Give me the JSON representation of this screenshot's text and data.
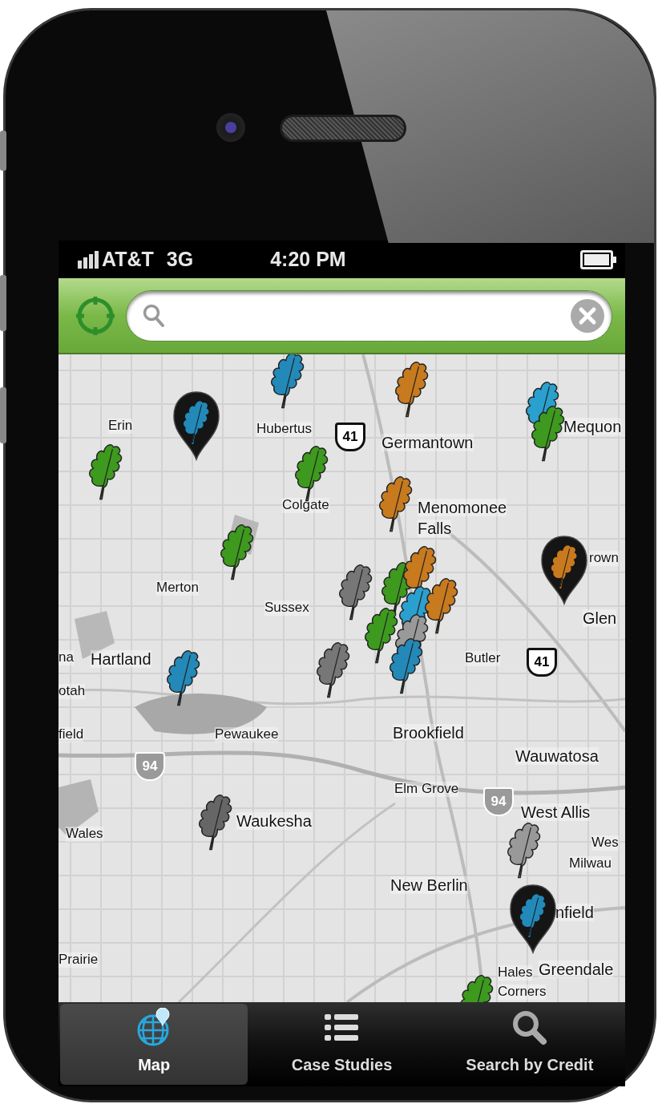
{
  "status_bar": {
    "carrier": "AT&T",
    "network": "3G",
    "time": "4:20 PM"
  },
  "map": {
    "labels": [
      {
        "text": "Erin",
        "kind": "town"
      },
      {
        "text": "Hubertus",
        "kind": "town"
      },
      {
        "text": "Germantown",
        "kind": "city"
      },
      {
        "text": "Mequon",
        "kind": "city"
      },
      {
        "text": "Colgate",
        "kind": "town"
      },
      {
        "text": "Menomonee",
        "kind": "city"
      },
      {
        "text": "Falls",
        "kind": "city"
      },
      {
        "text": "rown",
        "kind": "town"
      },
      {
        "text": "Merton",
        "kind": "town"
      },
      {
        "text": "Sussex",
        "kind": "town"
      },
      {
        "text": "Glen",
        "kind": "city"
      },
      {
        "text": "na",
        "kind": "town"
      },
      {
        "text": "Hartland",
        "kind": "city"
      },
      {
        "text": "Butler",
        "kind": "town"
      },
      {
        "text": "otah",
        "kind": "town"
      },
      {
        "text": "field",
        "kind": "town"
      },
      {
        "text": "Pewaukee",
        "kind": "town"
      },
      {
        "text": "Brookfield",
        "kind": "city"
      },
      {
        "text": "Wauwatosa",
        "kind": "city"
      },
      {
        "text": "Elm Grove",
        "kind": "town"
      },
      {
        "text": "West Allis",
        "kind": "city"
      },
      {
        "text": "Waukesha",
        "kind": "city"
      },
      {
        "text": "Wales",
        "kind": "town"
      },
      {
        "text": "Wes",
        "kind": "town"
      },
      {
        "text": "Milwau",
        "kind": "town"
      },
      {
        "text": "New Berlin",
        "kind": "city"
      },
      {
        "text": "nfield",
        "kind": "city"
      },
      {
        "text": "Prairie",
        "kind": "town"
      },
      {
        "text": "Hales",
        "kind": "town"
      },
      {
        "text": "Corners",
        "kind": "town"
      },
      {
        "text": "Greendale",
        "kind": "city"
      }
    ],
    "shields": [
      {
        "text": "41",
        "kind": "us"
      },
      {
        "text": "41",
        "kind": "us"
      },
      {
        "text": "94",
        "kind": "interstate"
      },
      {
        "text": "94",
        "kind": "interstate"
      }
    ],
    "pins": [
      {
        "kind": "leaf",
        "color": "#2389b8"
      },
      {
        "kind": "leaf",
        "color": "#c87a1e"
      },
      {
        "kind": "badge",
        "color": "#2389b8"
      },
      {
        "kind": "leaf",
        "color": "#2aa0cf"
      },
      {
        "kind": "leaf",
        "color": "#3d9a1e"
      },
      {
        "kind": "leaf",
        "color": "#3d9a1e"
      },
      {
        "kind": "leaf",
        "color": "#3d9a1e"
      },
      {
        "kind": "leaf",
        "color": "#c87a1e"
      },
      {
        "kind": "leaf",
        "color": "#3d9a1e"
      },
      {
        "kind": "badge",
        "color": "#c87a1e"
      },
      {
        "kind": "leaf",
        "color": "#777777"
      },
      {
        "kind": "leaf",
        "color": "#3d9a1e"
      },
      {
        "kind": "leaf",
        "color": "#c87a1e"
      },
      {
        "kind": "leaf",
        "color": "#2aa0cf"
      },
      {
        "kind": "leaf",
        "color": "#c87a1e"
      },
      {
        "kind": "leaf",
        "color": "#3d9a1e"
      },
      {
        "kind": "leaf",
        "color": "#999999"
      },
      {
        "kind": "leaf",
        "color": "#2389b8"
      },
      {
        "kind": "leaf",
        "color": "#777777"
      },
      {
        "kind": "leaf",
        "color": "#2389b8"
      },
      {
        "kind": "leaf",
        "color": "#666666"
      },
      {
        "kind": "leaf",
        "color": "#999999"
      },
      {
        "kind": "badge",
        "color": "#2389b8"
      },
      {
        "kind": "leaf",
        "color": "#3d9a1e"
      }
    ]
  },
  "tabs": [
    {
      "label": "Map",
      "selected": true
    },
    {
      "label": "Case Studies",
      "selected": false
    },
    {
      "label": "Search by Credit",
      "selected": false
    }
  ]
}
